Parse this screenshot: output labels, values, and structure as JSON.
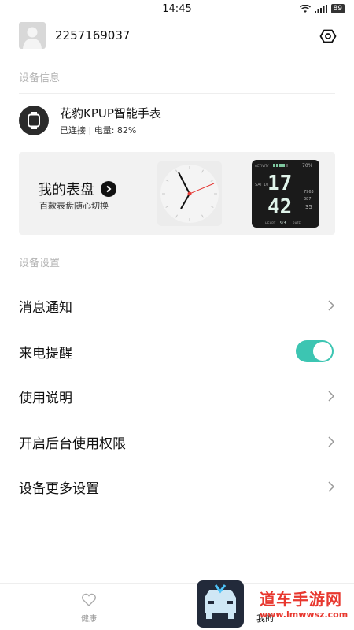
{
  "status_bar": {
    "time": "14:45",
    "battery": "89"
  },
  "profile": {
    "user_id": "2257169037"
  },
  "sections": {
    "device_info": "设备信息",
    "device_settings": "设备设置"
  },
  "device": {
    "name": "花豹KPUP智能手表",
    "status": "已连接 | 电量: 82%"
  },
  "watchface": {
    "title": "我的表盘",
    "subtitle": "百款表盘随心切换",
    "digital": {
      "hour": "17",
      "minute": "42",
      "battery": "70%",
      "date": "SAT 10",
      "top": "ACTIVITY",
      "v1": "7963",
      "v2": "387",
      "v3": "35",
      "heart": "93",
      "heart_label": "HEART",
      "rate_label": "RATE"
    }
  },
  "menu": [
    {
      "label": "消息通知",
      "type": "chevron"
    },
    {
      "label": "来电提醒",
      "type": "toggle",
      "on": true
    },
    {
      "label": "使用说明",
      "type": "chevron"
    },
    {
      "label": "开启后台使用权限",
      "type": "chevron"
    },
    {
      "label": "设备更多设置",
      "type": "chevron"
    }
  ],
  "bottom_nav": {
    "health": "健康",
    "mine": "我的"
  },
  "watermark": {
    "main": "道车手游网",
    "url": "www.lmwwsz.com"
  },
  "colors": {
    "accent": "#3cc5b2",
    "watermark": "#e8382f"
  }
}
